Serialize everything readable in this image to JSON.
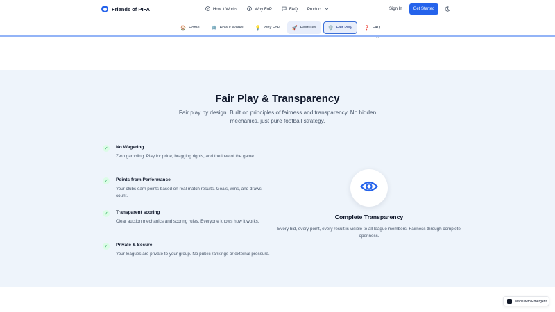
{
  "brand": {
    "name": "Friends of PIFA",
    "logo": "brand-logo-icon"
  },
  "topnav": {
    "items": [
      {
        "label": "How it Works",
        "icon": "circle-help-icon"
      },
      {
        "label": "Why FoP",
        "icon": "info-icon"
      },
      {
        "label": "FAQ",
        "icon": "chat-icon"
      },
      {
        "label": "Product",
        "icon": "chevron-down-icon"
      }
    ],
    "signin": "Sign In",
    "get_started": "Get Started",
    "theme_icon": "moon-icon"
  },
  "subnav": {
    "items": [
      {
        "label": "Home",
        "emoji": "🏠"
      },
      {
        "label": "How it Works",
        "emoji": "⚙️"
      },
      {
        "label": "Why FoP",
        "emoji": "💡"
      },
      {
        "label": "Features",
        "emoji": "🚀"
      },
      {
        "label": "Fair Play",
        "emoji": "🛡️"
      },
      {
        "label": "FAQ",
        "emoji": "❓"
      }
    ],
    "active": "Fair Play"
  },
  "ghost": {
    "left": "Detailed statistics",
    "right": "Strategy discussions"
  },
  "section": {
    "title": "Fair Play & Transparency",
    "subtitle": "Fair play by design. Built on principles of fairness and transparency. No hidden mechanics, just pure football strategy.",
    "features": [
      {
        "title": "No Wagering",
        "desc": "Zero gambling. Play for pride, bragging rights, and the love of the game."
      },
      {
        "title": "Points from Performance",
        "desc": "Your clubs earn points based on real match results. Goals, wins, and draws count."
      },
      {
        "title": "Transparent scoring",
        "desc": "Clear auction mechanics and scoring rules. Everyone knows how it works."
      },
      {
        "title": "Private & Secure",
        "desc": "Your leagues are private to your group. No public rankings or external pressure."
      }
    ],
    "card": {
      "icon": "eye-icon",
      "title": "Complete Transparency",
      "desc": "Every bid, every point, every result is visible to all league members. Fairness through complete openness."
    }
  },
  "badge": {
    "label": "Made with Emergent"
  },
  "colors": {
    "accent": "#2563eb",
    "section_bg": "#eef4fb",
    "check_green": "#16a34a"
  }
}
